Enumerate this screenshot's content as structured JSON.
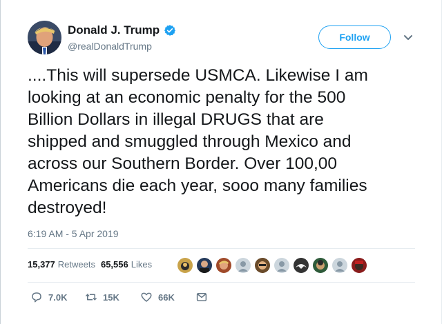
{
  "author": {
    "name": "Donald J. Trump",
    "handle": "@realDonaldTrump",
    "verified": true
  },
  "follow_label": "Follow",
  "tweet_text": "....This will supersede USMCA. Likewise I am\nlooking at an economic penalty for the 500\nBillion Dollars in illegal DRUGS that are\nshipped and smuggled through Mexico and\nacross our Southern Border. Over 100,00\nAmericans die each year, sooo many families\ndestroyed!",
  "timestamp": "6:19 AM - 5 Apr 2019",
  "stats": {
    "retweets_count": "15,377",
    "retweets_label": "Retweets",
    "likes_count": "65,556",
    "likes_label": "Likes"
  },
  "actions": {
    "reply_count": "7.0K",
    "retweet_count": "15K",
    "like_count": "66K"
  },
  "colors": {
    "accent": "#1da1f2",
    "text": "#14171a",
    "muted": "#657786",
    "divider": "#e6ecf0"
  },
  "icons": {
    "verified": "verified-badge-icon",
    "caret": "chevron-down-icon",
    "reply": "reply-icon",
    "retweet": "retweet-icon",
    "like": "heart-icon",
    "message": "direct-message-icon"
  },
  "liker_avatars_count": 10
}
